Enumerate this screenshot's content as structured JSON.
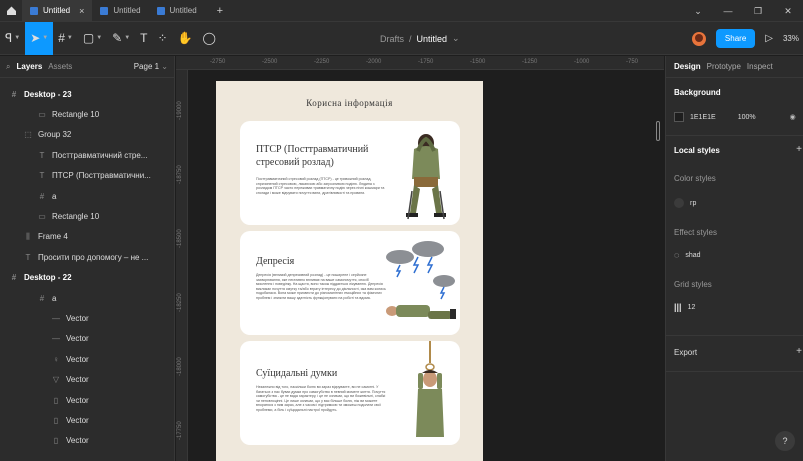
{
  "titlebar": {
    "tabs": [
      {
        "label": "Untitled",
        "active": true
      },
      {
        "label": "Untitled",
        "active": false
      },
      {
        "label": "Untitled",
        "active": false
      }
    ],
    "close_glyph": "×",
    "plus_glyph": "+"
  },
  "toolbar": {
    "breadcrumb_folder": "Drafts",
    "breadcrumb_sep": "/",
    "breadcrumb_file": "Untitled",
    "share_label": "Share",
    "zoom": "33%"
  },
  "left_panel": {
    "tab_layers": "Layers",
    "tab_assets": "Assets",
    "page_label": "Page 1",
    "layers": [
      {
        "icon": "frame-icon",
        "glyph": "#",
        "label": "Desktop - 23",
        "depth": 0,
        "frame": true
      },
      {
        "icon": "rectangle-icon",
        "glyph": "▭",
        "label": "Rectangle 10",
        "depth": 2,
        "frame": false
      },
      {
        "icon": "group-icon",
        "glyph": "⬚",
        "label": "Group 32",
        "depth": 1,
        "frame": false
      },
      {
        "icon": "text-icon",
        "glyph": "T",
        "label": "Посттравматичний стре...",
        "depth": 2,
        "frame": false
      },
      {
        "icon": "text-icon",
        "glyph": "T",
        "label": "ПТСР (Посттравматични...",
        "depth": 2,
        "frame": false
      },
      {
        "icon": "frame-icon",
        "glyph": "#",
        "label": "a",
        "depth": 2,
        "frame": false
      },
      {
        "icon": "rectangle-icon",
        "glyph": "▭",
        "label": "Rectangle 10",
        "depth": 2,
        "frame": false
      },
      {
        "icon": "auto-layout-icon",
        "glyph": "⫼",
        "label": "Frame 4",
        "depth": 1,
        "frame": false
      },
      {
        "icon": "text-icon",
        "glyph": "T",
        "label": "Просити про допомогу – не ...",
        "depth": 1,
        "frame": false
      },
      {
        "icon": "frame-icon",
        "glyph": "#",
        "label": "Desktop - 22",
        "depth": 0,
        "frame": true
      },
      {
        "icon": "frame-icon",
        "glyph": "#",
        "label": "a",
        "depth": 2,
        "frame": false
      },
      {
        "icon": "vector-line-icon",
        "glyph": "—",
        "label": "Vector",
        "depth": 3,
        "frame": false
      },
      {
        "icon": "vector-line-icon",
        "glyph": "—",
        "label": "Vector",
        "depth": 3,
        "frame": false
      },
      {
        "icon": "vector-icon",
        "glyph": "♀",
        "label": "Vector",
        "depth": 3,
        "frame": false
      },
      {
        "icon": "vector-icon",
        "glyph": "▽",
        "label": "Vector",
        "depth": 3,
        "frame": false
      },
      {
        "icon": "vector-icon",
        "glyph": "▯",
        "label": "Vector",
        "depth": 3,
        "frame": false
      },
      {
        "icon": "vector-icon",
        "glyph": "▯",
        "label": "Vector",
        "depth": 3,
        "frame": false
      },
      {
        "icon": "vector-icon",
        "glyph": "▯",
        "label": "Vector",
        "depth": 3,
        "frame": false
      }
    ]
  },
  "rulers": {
    "top": [
      "-2750",
      "-2500",
      "-2250",
      "-2000",
      "-1750",
      "-1500",
      "-1250",
      "-1000",
      "-750"
    ],
    "left": [
      "-19000",
      "-18750",
      "-18500",
      "-18250",
      "-18000",
      "-17750"
    ]
  },
  "document": {
    "title": "Корисна інформація",
    "cards": [
      {
        "title_line1": "ПТСР (Посттравматичний",
        "title_line2": "стресовий розлад)",
        "body": "Посттравматичний стресовий розлад (ПТСР) - це тривожний розлад, спричинений стресовою, лякаючою або загрозливою подією. Людина з розладом ПТСР часто переживає травматичну подію через нічні кошмари та спогади і може відчувати почуття вини, дратівливості та провини."
      },
      {
        "title_line1": "Депресія",
        "title_line2": "",
        "body": "Депресія (великий депресивний розлад) - це поширене і серйозне захворювання, яке негативно впливає на ваше самопочуття, спосіб мислення і поведінку. На щастя, воно також піддається лікуванню. Депресія викликає почуття смутку та/або втрату інтересу до діяльності, яка вам колись подобалася. Вона може призвести до різноманітних емоційних та фізичних проблем і знизити вашу здатність функціонувати на роботі та вдома."
      },
      {
        "title_line1": "Суїцидальні думки",
        "title_line2": "",
        "body": "Незалежно від того, наскільки болю ви зараз відчуваєте, ви не самотні. У багатьох з нас буває думки про самогубство в певний момент життя. Почуття самогубства - це не вада характеру, і це не означає, що ви божевільні, слабкі чи неповноцінні. Це лише означає, що у вас більше болю, ніж ви можете впоратися з ним зараз, але з часом і підтримкою ти зможеш подолати свої проблеми, а біль і суїцидальні настрої пройдуть."
      }
    ]
  },
  "right_panel": {
    "tab_design": "Design",
    "tab_prototype": "Prototype",
    "tab_inspect": "Inspect",
    "background_label": "Background",
    "background_hex": "1E1E1E",
    "background_opacity": "100%",
    "local_styles_label": "Local styles",
    "color_styles_label": "Color styles",
    "color_style_name": "гр",
    "effect_styles_label": "Effect styles",
    "effect_style_name": "shad",
    "grid_styles_label": "Grid styles",
    "grid_style_name": "12",
    "export_label": "Export",
    "help_glyph": "?"
  },
  "colors": {
    "accent": "#0d99ff",
    "panel": "#2c2c2c",
    "canvas": "#1e1e1e",
    "doc_bg": "#efe8dc",
    "card_bg": "#ffffff",
    "figure_green": "#7c8a5a"
  }
}
